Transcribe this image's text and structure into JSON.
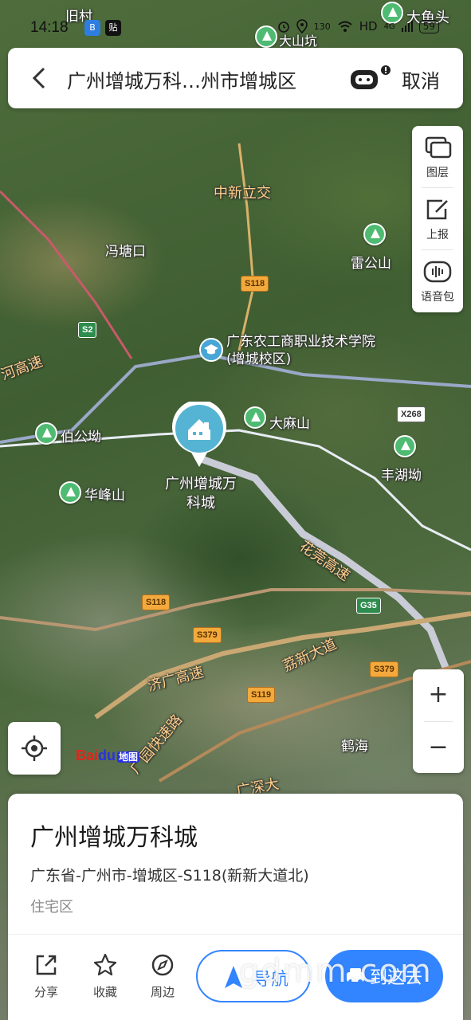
{
  "status_bar": {
    "time": "14:18",
    "app_icons": [
      "B",
      "贴"
    ],
    "speed": "130",
    "network": "HD",
    "signal": "4G",
    "battery": "59"
  },
  "search_bar": {
    "title": "广州增城万科…州市增城区",
    "cancel_label": "取消"
  },
  "map_tools": {
    "layers_label": "图层",
    "report_label": "上报",
    "voice_label": "语音包"
  },
  "zoom": {
    "in_label": "+",
    "out_label": "−"
  },
  "map": {
    "labels": {
      "old_village": "旧村",
      "dayutou": "大鱼头",
      "dashankeng": "大山坑",
      "zhongxin_interchange": "中新立交",
      "fengtangkou": "冯塘口",
      "leigongshan": "雷公山",
      "school": "广东农工商职业技术学院(增城校区)",
      "damashan": "大麻山",
      "baigongao": "伯公坳",
      "fenghuao": "丰湖坳",
      "huafengshan": "华峰山",
      "marker_title": "广州增城万科城",
      "huaguan_expressway": "花莞高速",
      "jiguang_expressway": "济广高速",
      "lixin_avenue": "荔新大道",
      "hehai": "鹤海",
      "road_west": "广园快速路",
      "guangshen": "广深大",
      "west_expressway": "河高速"
    },
    "shields": {
      "s118_a": "S118",
      "s2": "S2",
      "x268": "X268",
      "s118_b": "S118",
      "g35": "G35",
      "s379_a": "S379",
      "s379_b": "S379",
      "s119": "S119"
    },
    "logo": {
      "brand": "Bai",
      "paw": "du",
      "map": "地图"
    }
  },
  "place_card": {
    "name": "广州增城万科城",
    "address": "广东省-广州市-增城区-S118(新新大道北)",
    "category": "住宅区",
    "actions": {
      "share": "分享",
      "favorite": "收藏",
      "nearby": "周边"
    },
    "navigate_label": "导航",
    "go_label": "到这去"
  },
  "watermark": "gdmm.com",
  "colors": {
    "accent": "#3385ff",
    "poi_green": "#4fbb72",
    "marker_blue": "#48a6d6",
    "shield_orange": "#f3a93b",
    "expressway_green": "#2d8c4e"
  }
}
